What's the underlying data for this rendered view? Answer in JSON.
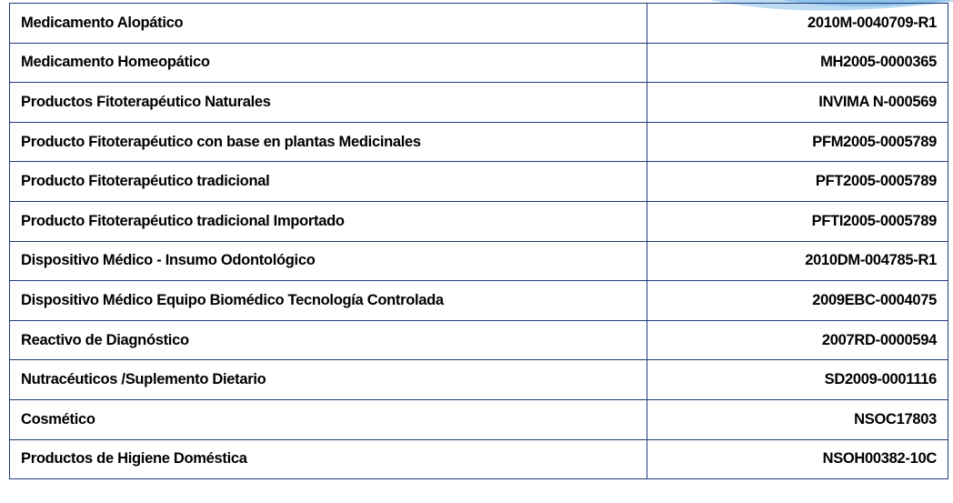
{
  "table": {
    "rows": [
      {
        "product": "Medicamento Alopático",
        "code": "2010M-0040709-R1"
      },
      {
        "product": "Medicamento Homeopático",
        "code": "MH2005-0000365"
      },
      {
        "product": "Productos Fitoterapéutico Naturales",
        "code": "INVIMA N-000569"
      },
      {
        "product": "Producto Fitoterapéutico con base en plantas Medicinales",
        "code": "PFM2005-0005789"
      },
      {
        "product": "Producto Fitoterapéutico tradicional",
        "code": "PFT2005-0005789"
      },
      {
        "product": "Producto Fitoterapéutico tradicional Importado",
        "code": "PFTI2005-0005789"
      },
      {
        "product": "Dispositivo Médico - Insumo Odontológico",
        "code": "2010DM-004785-R1"
      },
      {
        "product": "Dispositivo Médico Equipo Biomédico Tecnología Controlada",
        "code": "2009EBC-0004075"
      },
      {
        "product": "Reactivo de Diagnóstico",
        "code": "2007RD-0000594"
      },
      {
        "product": "Nutracéuticos /Suplemento Dietario",
        "code": "SD2009-0001116"
      },
      {
        "product": "Cosmético",
        "code": "NSOC17803"
      },
      {
        "product": "Productos de Higiene Doméstica",
        "code": "NSOH00382-10C"
      }
    ]
  },
  "colors": {
    "border": "#1f3a7a",
    "accent": "#8fc3ea"
  }
}
